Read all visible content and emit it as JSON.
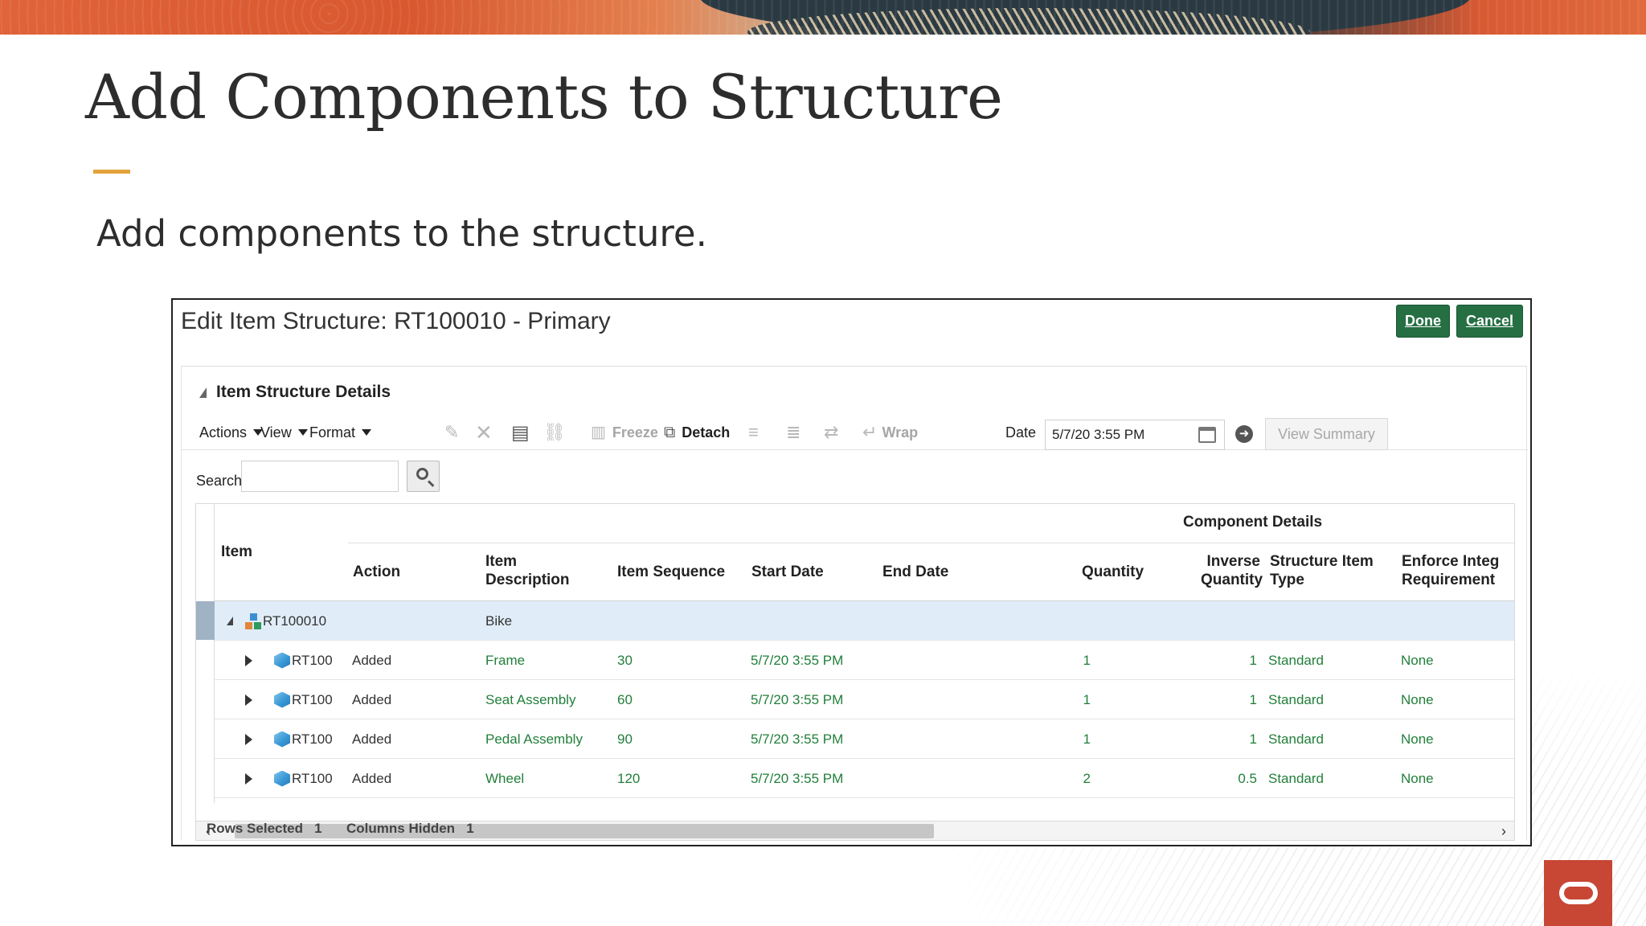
{
  "slide": {
    "title": "Add Components to Structure",
    "subtitle": "Add components to the structure."
  },
  "panel": {
    "title": "Edit Item Structure: RT100010 - Primary",
    "done_label": "Done",
    "cancel_label": "Cancel",
    "section_title": "Item Structure Details"
  },
  "toolbar": {
    "actions": "Actions",
    "view": "View",
    "format": "Format",
    "freeze": "Freeze",
    "detach": "Detach",
    "wrap": "Wrap",
    "date_label": "Date",
    "date_value": "5/7/20 3:55 PM",
    "view_summary": "View Summary",
    "icons": [
      "edit-icon",
      "delete-icon",
      "add-row-icon",
      "link-icon",
      "freeze-icon",
      "detach-icon",
      "indent-icon",
      "outdent-icon",
      "move-icon",
      "wrap-icon",
      "calendar-icon",
      "go-icon"
    ]
  },
  "search": {
    "label": "Search",
    "value": ""
  },
  "table": {
    "group_header": "Component Details",
    "headers": {
      "item": "Item",
      "action": "Action",
      "desc_1": "Item",
      "desc_2": "Description",
      "sequence": "Item Sequence",
      "start": "Start Date",
      "end": "End Date",
      "quantity": "Quantity",
      "inv_1": "Inverse",
      "inv_2": "Quantity",
      "type_1": "Structure Item",
      "type_2": "Type",
      "enf_1": "Enforce Integ",
      "enf_2": "Requirement"
    },
    "root": {
      "item": "RT100010",
      "description": "Bike"
    },
    "rows": [
      {
        "item": "RT100",
        "action": "Added",
        "description": "Frame",
        "sequence": "30",
        "start": "5/7/20 3:55 PM",
        "end": "",
        "quantity": "1",
        "inverse": "1",
        "type": "Standard",
        "enforce": "None"
      },
      {
        "item": "RT100",
        "action": "Added",
        "description": "Seat Assembly",
        "sequence": "60",
        "start": "5/7/20 3:55 PM",
        "end": "",
        "quantity": "1",
        "inverse": "1",
        "type": "Standard",
        "enforce": "None"
      },
      {
        "item": "RT100",
        "action": "Added",
        "description": "Pedal Assembly",
        "sequence": "90",
        "start": "5/7/20 3:55 PM",
        "end": "",
        "quantity": "1",
        "inverse": "1",
        "type": "Standard",
        "enforce": "None"
      },
      {
        "item": "RT100",
        "action": "Added",
        "description": "Wheel",
        "sequence": "120",
        "start": "5/7/20 3:55 PM",
        "end": "",
        "quantity": "2",
        "inverse": "0.5",
        "type": "Standard",
        "enforce": "None"
      }
    ]
  },
  "status": {
    "rows_selected_label": "Rows Selected",
    "rows_selected_value": "1",
    "columns_hidden_label": "Columns Hidden",
    "columns_hidden_value": "1"
  },
  "colors": {
    "accent_green": "#256f43",
    "value_green": "#217f3a",
    "selected_row": "#e0edf8",
    "title_rule": "#e3a33c",
    "oracle_red": "#c74634"
  }
}
